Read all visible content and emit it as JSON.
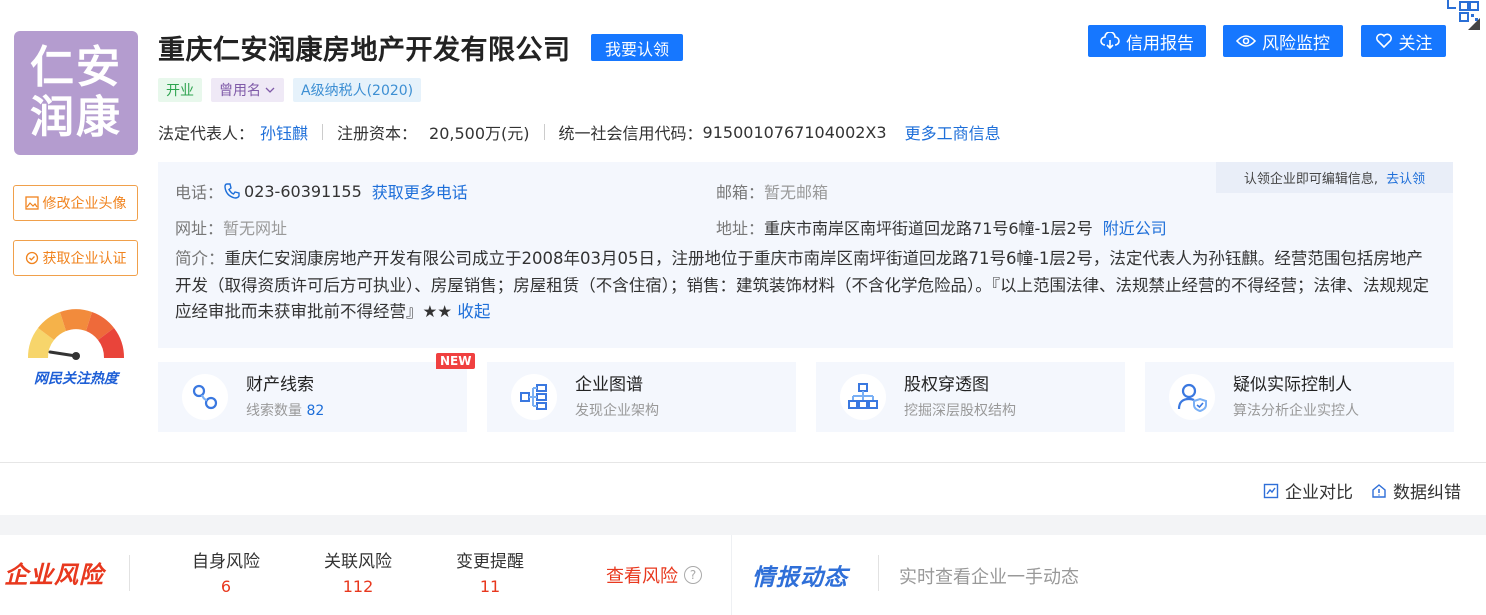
{
  "company": {
    "name": "重庆仁安润康房地产开发有限公司",
    "logo_text": [
      "仁安",
      "润康"
    ],
    "claim_button": "我要认领",
    "tags": [
      "开业",
      "曾用名",
      "A级纳税人(2020)"
    ]
  },
  "basic": {
    "legal_rep_label": "法定代表人：",
    "legal_rep": "孙钰麒",
    "capital_label": "注册资本：",
    "capital": "20,500万(元)",
    "credit_code_label": "统一社会信用代码：",
    "credit_code": "9150010767104002X3",
    "more_link": "更多工商信息"
  },
  "actions": {
    "credit_report": "信用报告",
    "risk_monitor": "风险监控",
    "follow": "关注"
  },
  "side": {
    "edit_avatar": "修改企业头像",
    "get_cert": "获取企业认证",
    "heat_label": "网民关注热度"
  },
  "contact": {
    "claim_tip": "认领企业即可编辑信息,",
    "claim_link": "去认领",
    "phone_label": "电话：",
    "phone": "023-60391155",
    "phone_more": "获取更多电话",
    "email_label": "邮箱：",
    "email": "暂无邮箱",
    "website_label": "网址：",
    "website": "暂无网址",
    "address_label": "地址：",
    "address": "重庆市南岸区南坪街道回龙路71号6幢-1层2号",
    "nearby": "附近公司",
    "intro_label": "简介：",
    "intro": "重庆仁安润康房地产开发有限公司成立于2008年03月05日，注册地位于重庆市南岸区南坪街道回龙路71号6幢-1层2号，法定代表人为孙钰麒。经营范围包括房地产开发（取得资质许可后方可执业）、房屋销售；房屋租赁（不含住宿）；销售：建筑装饰材料（不含化学危险品）。『以上范围法律、法规禁止经营的不得经营；法律、法规规定应经审批而未获审批前不得经营』★★",
    "collapse": "收起"
  },
  "features": [
    {
      "title": "财产线索",
      "sub": "线索数量",
      "count": "82",
      "icon": "property-clue-icon"
    },
    {
      "title": "企业图谱",
      "sub": "发现企业架构",
      "icon": "enterprise-graph-icon"
    },
    {
      "title": "股权穿透图",
      "sub": "挖掘深层股权结构",
      "icon": "equity-tree-icon"
    },
    {
      "title": "疑似实际控制人",
      "sub": "算法分析企业实控人",
      "icon": "controller-icon"
    }
  ],
  "new_badge": "NEW",
  "tools": {
    "compare": "企业对比",
    "correct": "数据纠错"
  },
  "risk": {
    "title": "企业风险",
    "items": [
      {
        "label": "自身风险",
        "value": "6"
      },
      {
        "label": "关联风险",
        "value": "112"
      },
      {
        "label": "变更提醒",
        "value": "11"
      }
    ],
    "view": "查看风险",
    "intel_title": "情报动态",
    "intel_sub": "实时查看企业一手动态"
  },
  "colors": {
    "primary": "#1677ff",
    "risk": "#e8381e",
    "logo_bg": "#b49ccf",
    "orange": "#f0831e"
  }
}
